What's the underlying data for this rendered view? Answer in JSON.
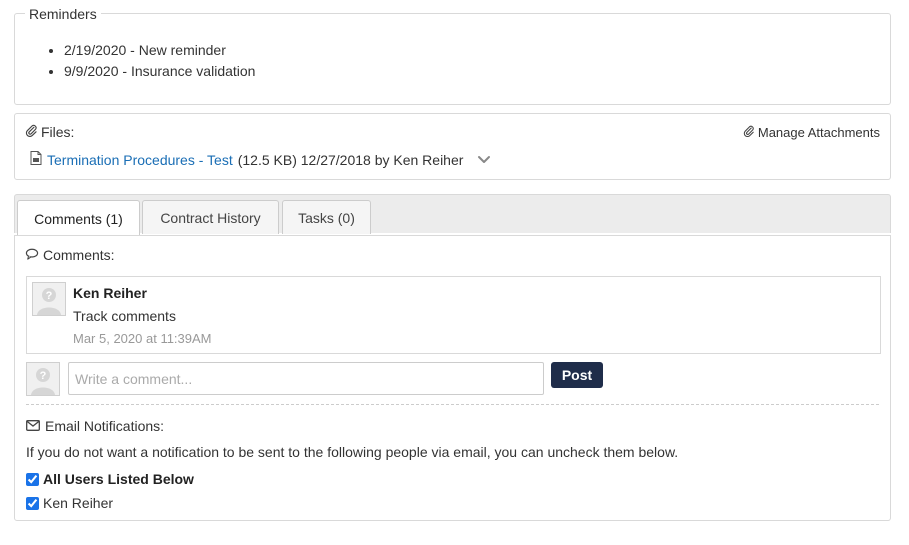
{
  "reminders": {
    "title": "Reminders",
    "items": [
      "2/19/2020 - New reminder",
      "9/9/2020 - Insurance validation"
    ]
  },
  "files": {
    "label": "Files:",
    "manage_label": "Manage Attachments",
    "file": {
      "name": "Termination Procedures - Test",
      "meta": "(12.5 KB) 12/27/2018 by Ken Reiher"
    },
    "icons": {
      "paperclip": "paperclip-icon",
      "file": "file-icon",
      "chevron": "chevron-down-icon"
    }
  },
  "tabs": [
    {
      "label": "Comments (1)",
      "active": true
    },
    {
      "label": "Contract History",
      "active": false
    },
    {
      "label": "Tasks (0)",
      "active": false
    }
  ],
  "comments": {
    "heading": "Comments:",
    "items": [
      {
        "author": "Ken Reiher",
        "text": "Track comments",
        "time": "Mar 5, 2020 at 11:39AM"
      }
    ],
    "input_placeholder": "Write a comment...",
    "post_label": "Post"
  },
  "email": {
    "heading": "Email Notifications:",
    "description": "If you do not want a notification to be sent to the following people via email, you can uncheck them below.",
    "options": [
      {
        "label": "All Users Listed Below",
        "checked": true
      },
      {
        "label": "Ken Reiher",
        "checked": true
      }
    ]
  },
  "colors": {
    "link": "#1a6eb5",
    "post_button": "#1f2d4a",
    "border": "#d9d9d9"
  }
}
